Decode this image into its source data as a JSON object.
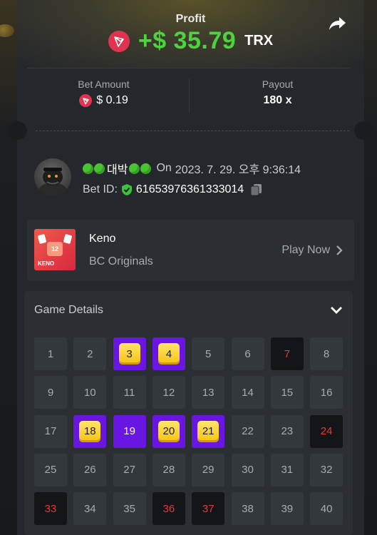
{
  "profit": {
    "label": "Profit",
    "value": "+$ 35.79",
    "currency": "TRX",
    "icon": "tron-coin-icon"
  },
  "bet_amount": {
    "label": "Bet Amount",
    "value": "$ 0.19"
  },
  "payout": {
    "label": "Payout",
    "value": "180 x"
  },
  "player": {
    "name": "대박",
    "on_label": "On",
    "datetime": "2023. 7. 29. 오후 9:36:14",
    "bet_id_label": "Bet ID:",
    "bet_id": "61653976361333014"
  },
  "game": {
    "name": "Keno",
    "provider": "BC Originals",
    "play_label": "Play Now",
    "thumb_label": "KENO",
    "thumb_num": "12"
  },
  "details": {
    "title": "Game Details",
    "cells": [
      {
        "n": "1",
        "state": "idle"
      },
      {
        "n": "2",
        "state": "idle"
      },
      {
        "n": "3",
        "state": "hit"
      },
      {
        "n": "4",
        "state": "hit"
      },
      {
        "n": "5",
        "state": "idle"
      },
      {
        "n": "6",
        "state": "idle"
      },
      {
        "n": "7",
        "state": "miss"
      },
      {
        "n": "8",
        "state": "idle"
      },
      {
        "n": "9",
        "state": "idle"
      },
      {
        "n": "10",
        "state": "idle"
      },
      {
        "n": "11",
        "state": "idle"
      },
      {
        "n": "12",
        "state": "idle"
      },
      {
        "n": "13",
        "state": "idle"
      },
      {
        "n": "14",
        "state": "idle"
      },
      {
        "n": "15",
        "state": "idle"
      },
      {
        "n": "16",
        "state": "idle"
      },
      {
        "n": "17",
        "state": "idle"
      },
      {
        "n": "18",
        "state": "hit"
      },
      {
        "n": "19",
        "state": "sel"
      },
      {
        "n": "20",
        "state": "hit"
      },
      {
        "n": "21",
        "state": "hit"
      },
      {
        "n": "22",
        "state": "idle"
      },
      {
        "n": "23",
        "state": "idle"
      },
      {
        "n": "24",
        "state": "miss"
      },
      {
        "n": "25",
        "state": "idle"
      },
      {
        "n": "26",
        "state": "idle"
      },
      {
        "n": "27",
        "state": "idle"
      },
      {
        "n": "28",
        "state": "idle"
      },
      {
        "n": "29",
        "state": "idle"
      },
      {
        "n": "30",
        "state": "idle"
      },
      {
        "n": "31",
        "state": "idle"
      },
      {
        "n": "32",
        "state": "idle"
      },
      {
        "n": "33",
        "state": "miss"
      },
      {
        "n": "34",
        "state": "idle"
      },
      {
        "n": "35",
        "state": "idle"
      },
      {
        "n": "36",
        "state": "miss"
      },
      {
        "n": "37",
        "state": "miss"
      },
      {
        "n": "38",
        "state": "idle"
      },
      {
        "n": "39",
        "state": "idle"
      },
      {
        "n": "40",
        "state": "idle"
      }
    ]
  },
  "colors": {
    "profit": "#4ed23f",
    "selected": "#6a16e2",
    "hit_gem": "#f6c20e",
    "miss_text": "#e13a3a",
    "tron": "#e0334f"
  }
}
